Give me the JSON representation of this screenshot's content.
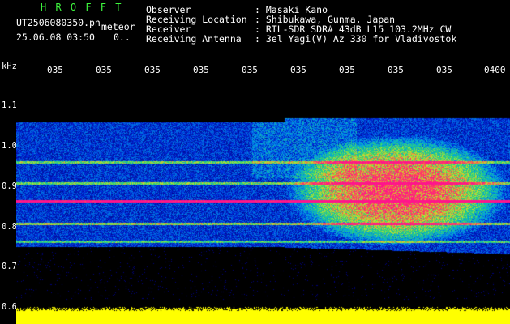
{
  "header": {
    "app_title": "H R O F F T",
    "filename": "UT2506080350.pn",
    "mode": "meteor",
    "datetime": "25.06.08 03:50",
    "counter": "0..",
    "fields": [
      {
        "label": "Observer",
        "value": ": Masaki Kano"
      },
      {
        "label": "Receiving Location",
        "value": ": Shibukawa, Gunma, Japan"
      },
      {
        "label": "Receiver",
        "value": ": RTL-SDR SDR# 43dB L15 103.2MHz CW"
      },
      {
        "label": "Receiving Antenna",
        "value": ": 3el Yagi(V) Az 330 for Vladivostok"
      }
    ]
  },
  "y_axis": {
    "unit": "kHz",
    "labels": [
      "1.1",
      "1.0",
      "0.9",
      "0.8",
      "0.7",
      "0.6"
    ]
  },
  "x_axis": {
    "labels": [
      "035",
      "035",
      "035",
      "035",
      "035",
      "035",
      "035",
      "035",
      "035",
      "0400"
    ]
  },
  "colors": {
    "background": "#000000",
    "text": "#ffffff",
    "title": "#3df53d",
    "signal_strip": "#ffff00"
  }
}
